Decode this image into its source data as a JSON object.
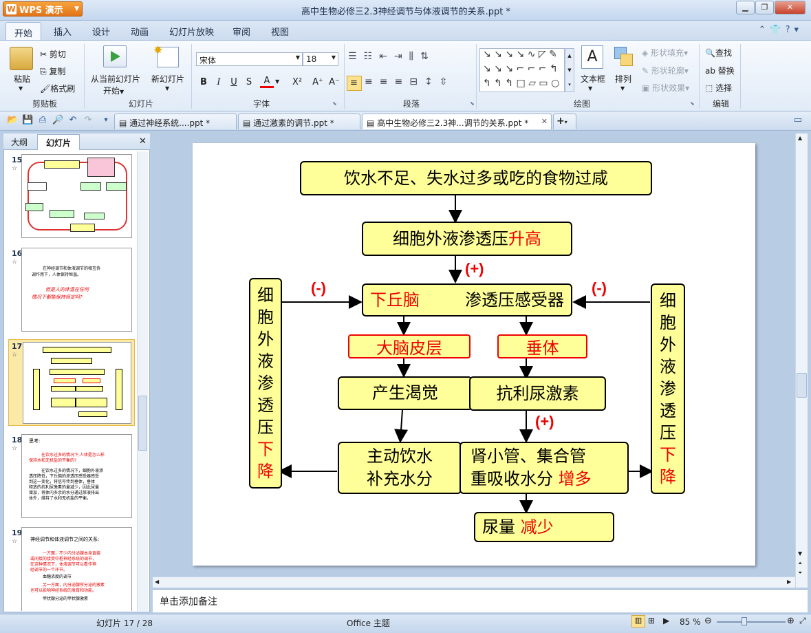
{
  "app": {
    "name": "WPS 演示",
    "window_title": "高中生物必修三2.3神经调节与体液调节的关系.ppt *"
  },
  "menu": {
    "tabs": [
      "开始",
      "插入",
      "设计",
      "动画",
      "幻灯片放映",
      "审阅",
      "视图"
    ]
  },
  "ribbon": {
    "clipboard": {
      "paste": "粘贴",
      "cut": "剪切",
      "copy": "复制",
      "format_painter": "格式刷",
      "label": "剪贴板"
    },
    "slides": {
      "from_current": "从当前幻灯片",
      "start": "开始",
      "new_slide": "新幻灯片",
      "label": "幻灯片"
    },
    "font": {
      "name": "宋体",
      "size": "18",
      "label": "字体",
      "bold": "B",
      "italic": "I",
      "underline": "U",
      "shadow": "S",
      "color": "A",
      "superscript": "X²",
      "grow": "A⁺",
      "shrink": "A⁻"
    },
    "paragraph": {
      "label": "段落"
    },
    "drawing": {
      "textbox": "文本框",
      "arrange": "排列",
      "fill": "形状填充",
      "outline": "形状轮廓",
      "effects": "形状效果",
      "label": "绘图"
    },
    "editing": {
      "find": "查找",
      "replace": "替换",
      "select": "选择",
      "label": "编辑"
    }
  },
  "doc_tabs": [
    {
      "label": "通过神经系统....ppt *"
    },
    {
      "label": "通过激素的调节.ppt *"
    },
    {
      "label": "高中生物必修三2.3神...调节的关系.ppt *"
    }
  ],
  "left_panel": {
    "tabs": [
      "大纲",
      "幻灯片"
    ],
    "slides": [
      {
        "num": "15"
      },
      {
        "num": "16",
        "lines": [
          "在神经调节和体液调节的相互协",
          "调作用下，人体保持恒温。",
          "但是人的体温在任何",
          "情况下都能保持恒定吗?"
        ]
      },
      {
        "num": "17"
      },
      {
        "num": "18",
        "title": "思考:",
        "q": [
          "在饮水过多的情况下,人体是怎么样",
          "保持水和无机盐的平衡的?"
        ],
        "a": [
          "在饮水过多的情况下，细胞外液渗",
          "透压降低，下丘脑的渗透压感受器感受",
          "到这一变化，将信号传到垂体，垂体",
          "释放的抗利尿激素的量减少，因此尿量",
          "增加，将体内多余的水分通过尿液排出",
          "体外，维持了水和无机盐的平衡。"
        ]
      },
      {
        "num": "19",
        "title": "神经调节和体液调节之间的关系:",
        "lines": [
          "一方面，不少内分泌腺本身直接",
          "或间接的接受中枢神经系统的调节，",
          "在这种情况下，体液调节可以看作神",
          "经调节的一个环节。",
          "血糖浓度的调节",
          "另一方面，内分泌腺所分泌的激素",
          "也可以影响神经系统的发育和功能。",
          "甲状腺分泌的甲状腺激素"
        ]
      }
    ]
  },
  "slide": {
    "top": "饮水不足、失水过多或吃的食物过咸",
    "osmo": {
      "text": "细胞外液渗透压",
      "red": "升高"
    },
    "hypo": {
      "red": "下丘脑",
      "text": "渗透压感受器"
    },
    "cortex": "大脑皮层",
    "pituitary": "垂体",
    "thirst": "产生渴觉",
    "adh": "抗利尿激素",
    "drink": [
      "主动饮水",
      "补充水分"
    ],
    "kidney": {
      "line1": "肾小管、集合管",
      "line2": "重吸收水分",
      "red": "增多"
    },
    "urine": {
      "text": "尿量",
      "red": "减少"
    },
    "side": {
      "chars": [
        "细",
        "胞",
        "外",
        "液",
        "渗",
        "透",
        "压"
      ],
      "red": [
        "下",
        "降"
      ]
    },
    "signs": {
      "plus": "(+)",
      "minus": "(-)"
    }
  },
  "notes": {
    "placeholder": "单击添加备注"
  },
  "status": {
    "slide_info": "幻灯片 17 / 28",
    "theme": "Office 主题",
    "zoom": "85 %"
  }
}
